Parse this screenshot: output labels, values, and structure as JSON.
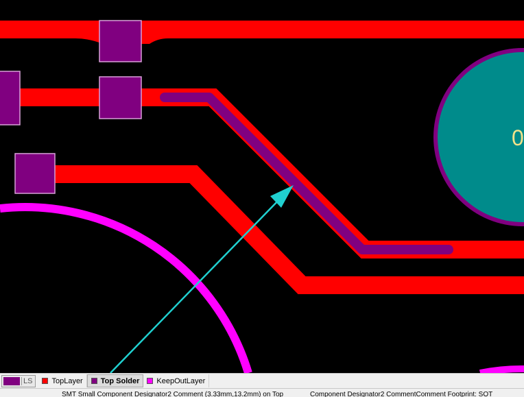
{
  "canvas": {
    "background_color": "#000000",
    "layer_colors": {
      "top_layer": "#ff0000",
      "top_solder": "#800080",
      "keep_out_layer": "#ff00ff",
      "via_pad_fill": "#008b8b",
      "highlight_arrow": "#20d0d0"
    },
    "pad_label": "0"
  },
  "layer_bar": {
    "ls_label": "LS",
    "ls_color": "#800080",
    "tabs": [
      {
        "label": "TopLayer",
        "color": "#ff0000",
        "active": false
      },
      {
        "label": "Top Solder",
        "color": "#800080",
        "active": true
      },
      {
        "label": "KeepOutLayer",
        "color": "#ff00ff",
        "active": false
      }
    ]
  },
  "status_bar": {
    "left_text": "SMT Small Component Designator2 Comment (3.33mm,13.2mm) on Top",
    "right_text": "Component Designator2 CommentComment Footprint: SOT"
  }
}
